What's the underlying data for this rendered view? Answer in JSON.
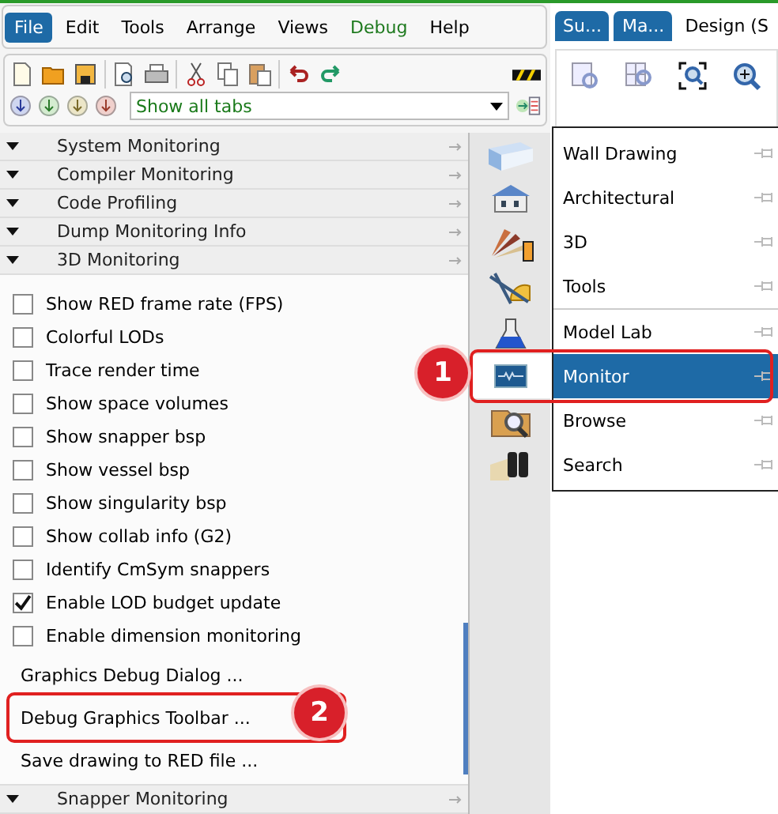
{
  "menu_bar": [
    {
      "label": "File",
      "selected": true,
      "kind": "normal"
    },
    {
      "label": "Edit",
      "selected": false,
      "kind": "normal"
    },
    {
      "label": "Tools",
      "selected": false,
      "kind": "normal"
    },
    {
      "label": "Arrange",
      "selected": false,
      "kind": "normal"
    },
    {
      "label": "Views",
      "selected": false,
      "kind": "normal"
    },
    {
      "label": "Debug",
      "selected": false,
      "kind": "debug"
    },
    {
      "label": "Help",
      "selected": false,
      "kind": "normal"
    }
  ],
  "app_tabs": [
    {
      "label": "Su...",
      "selected": true
    },
    {
      "label": "Ma...",
      "selected": true
    },
    {
      "label": "Design (S",
      "selected": false
    }
  ],
  "tab_filter": {
    "value": "Show all tabs"
  },
  "sections": [
    {
      "label": "System Monitoring"
    },
    {
      "label": "Compiler Monitoring"
    },
    {
      "label": "Code Profiling"
    },
    {
      "label": "Dump Monitoring Info"
    },
    {
      "label": "3D Monitoring"
    }
  ],
  "options": [
    {
      "label": "Show RED frame rate (FPS)",
      "checked": false
    },
    {
      "label": "Colorful LODs",
      "checked": false
    },
    {
      "label": "Trace render time",
      "checked": false
    },
    {
      "label": "Show space volumes",
      "checked": false
    },
    {
      "label": "Show snapper bsp",
      "checked": false
    },
    {
      "label": "Show vessel bsp",
      "checked": false
    },
    {
      "label": "Show singularity bsp",
      "checked": false
    },
    {
      "label": "Show collab info (G2)",
      "checked": false
    },
    {
      "label": "Identify CmSym snappers",
      "checked": false
    },
    {
      "label": "Enable LOD budget update",
      "checked": true
    },
    {
      "label": "Enable dimension monitoring",
      "checked": false
    }
  ],
  "actions": [
    {
      "label": "Graphics Debug Dialog ..."
    },
    {
      "label": "Debug Graphics Toolbar ..."
    },
    {
      "label": "Save drawing to RED file ..."
    }
  ],
  "bottom_section": {
    "label": "Snapper Monitoring"
  },
  "category_menu": [
    {
      "label": "Wall Drawing",
      "selected": false,
      "separator_before": false
    },
    {
      "label": "Architectural",
      "selected": false,
      "separator_before": false
    },
    {
      "label": "3D",
      "selected": false,
      "separator_before": false
    },
    {
      "label": "Tools",
      "selected": false,
      "separator_before": false
    },
    {
      "label": "Model Lab",
      "selected": false,
      "separator_before": true
    },
    {
      "label": "Monitor",
      "selected": true,
      "separator_before": false
    },
    {
      "label": "Browse",
      "selected": false,
      "separator_before": false
    },
    {
      "label": "Search",
      "selected": false,
      "separator_before": false
    }
  ],
  "annotations": [
    {
      "label": "1"
    },
    {
      "label": "2"
    }
  ]
}
